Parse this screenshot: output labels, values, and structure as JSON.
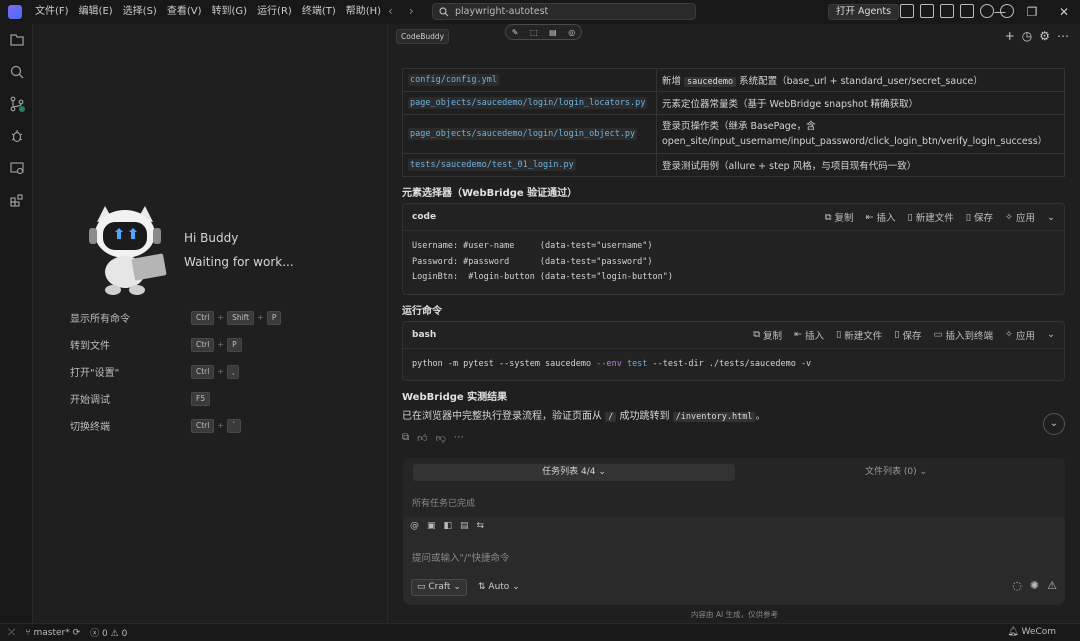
{
  "titlebar": {
    "menu": [
      "文件(F)",
      "编辑(E)",
      "选择(S)",
      "查看(V)",
      "转到(G)",
      "运行(R)",
      "终端(T)",
      "帮助(H)"
    ],
    "search": "playwright-autotest",
    "agents_button": "打开 Agents",
    "window_controls": [
      "—",
      "❐",
      "✕"
    ]
  },
  "welcome": {
    "greeting": "Hi Buddy",
    "status": "Waiting for work...",
    "shortcuts": [
      {
        "label": "显示所有命令",
        "keys": [
          "Ctrl",
          "Shift",
          "P"
        ]
      },
      {
        "label": "转到文件",
        "keys": [
          "Ctrl",
          "P"
        ]
      },
      {
        "label": "打开\"设置\"",
        "keys": [
          "Ctrl",
          ","
        ]
      },
      {
        "label": "开始调试",
        "keys": [
          "F5"
        ]
      },
      {
        "label": "切换终端",
        "keys": [
          "Ctrl",
          "`"
        ]
      }
    ]
  },
  "chat": {
    "tab_label": "CodeBuddy",
    "files_table": [
      {
        "path": "config/config.yml",
        "desc_pre": "新增 ",
        "desc_code": "saucedemo",
        "desc_post": " 系统配置（base_url + standard_user/secret_sauce）"
      },
      {
        "path": "page_objects/saucedemo/login/login_locators.py",
        "desc_pre": "元素定位器常量类（基于 WebBridge snapshot 精确获取）",
        "desc_code": "",
        "desc_post": ""
      },
      {
        "path": "page_objects/saucedemo/login/login_object.py",
        "desc_pre": "登录页操作类（继承 BasePage，含 open_site/input_username/input_password/click_login_btn/verify_login_success）",
        "desc_code": "",
        "desc_post": ""
      },
      {
        "path": "tests/saucedemo/test_01_login.py",
        "desc_pre": "登录测试用例（allure + step 风格，与项目现有代码一致）",
        "desc_code": "",
        "desc_post": ""
      }
    ],
    "section_selectors": "元素选择器（WebBridge 验证通过）",
    "code1": {
      "lang": "code",
      "actions": [
        "复制",
        "插入",
        "新建文件",
        "保存",
        "应用"
      ],
      "lines": [
        "Username: #user-name     (data-test=\"username\")",
        "Password: #password      (data-test=\"password\")",
        "LoginBtn:  #login-button (data-test=\"login-button\")"
      ]
    },
    "section_run": "运行命令",
    "code2": {
      "lang": "bash",
      "actions": [
        "复制",
        "插入",
        "新建文件",
        "保存",
        "插入到终端",
        "应用"
      ],
      "cmd_a": "python -m pytest --system saucedemo ",
      "cmd_kw": "--env",
      "cmd_fn": " test",
      "cmd_b": " --test-dir ./tests/saucedemo -v"
    },
    "section_result": "WebBridge 实测结果",
    "result_pre": "已在浏览器中完整执行登录流程，验证页面从 ",
    "result_code1": "/",
    "result_mid": " 成功跳转到 ",
    "result_code2": "/inventory.html",
    "result_post": "。",
    "task_tab": "任务列表 4/4",
    "file_tab": "文件列表 (0)",
    "all_done": "所有任务已完成",
    "input_placeholder": "提问或输入\"/\"快捷命令",
    "mode": "Craft",
    "auto": "Auto",
    "disclaimer": "内容由 AI 生成，仅供参考"
  },
  "statusbar": {
    "branch": "master*",
    "errors": "0",
    "warnings": "0",
    "wecom": "WeCom"
  }
}
